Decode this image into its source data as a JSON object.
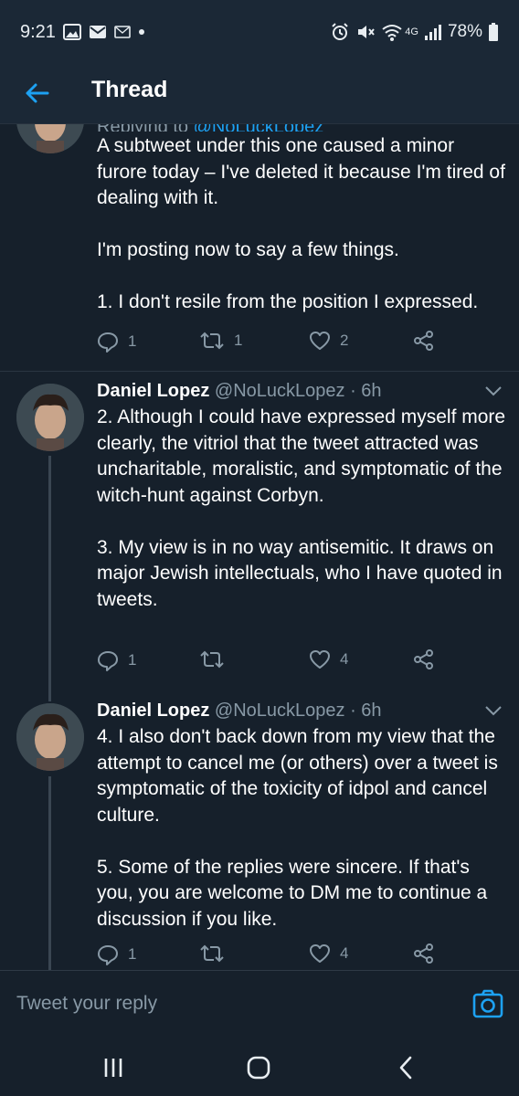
{
  "status_bar": {
    "time": "9:21",
    "network": "4G",
    "battery": "78%"
  },
  "header": {
    "title": "Thread"
  },
  "tweets": [
    {
      "replying_prefix": "Replying to",
      "replying_handle": "@NoLuckLopez",
      "text": "A subtweet under this one caused a minor furore today – I've deleted it because I'm tired of dealing with it.\n\nI'm posting now to say a few things.\n\n1. I don't resile from the position I expressed.",
      "replies": "1",
      "retweets": "1",
      "likes": "2"
    },
    {
      "name": "Daniel Lopez",
      "handle_time": "@NoLuckLopez · 6h",
      "text": "2. Although I could have expressed myself more clearly, the vitriol that the tweet attracted was uncharitable, moralistic, and symptomatic of the witch-hunt against Corbyn.\n\n3. My view is in no way antisemitic. It draws on major Jewish intellectuals, who I have quoted in tweets.",
      "replies": "1",
      "retweets": "",
      "likes": "4"
    },
    {
      "name": "Daniel Lopez",
      "handle_time": "@NoLuckLopez · 6h",
      "text": "4. I also don't back down from my view that the attempt to cancel me (or others) over a tweet is symptomatic of the toxicity of idpol and cancel culture.\n\n5. Some of the replies were sincere. If that's you, you are welcome to DM me to continue a discussion if you like.",
      "replies": "1",
      "retweets": "",
      "likes": "4"
    }
  ],
  "reply_bar": {
    "placeholder": "Tweet your reply"
  },
  "colors": {
    "background": "#16202b",
    "accent": "#1da1f2",
    "muted": "#8899a6"
  },
  "icons": [
    "gallery-icon",
    "mail-icon",
    "message-icon",
    "alarm-icon",
    "mute-icon",
    "wifi-icon",
    "signal-icon",
    "battery-icon",
    "back-arrow-icon",
    "reply-icon",
    "retweet-icon",
    "like-icon",
    "share-icon",
    "chevron-down-icon",
    "camera-icon",
    "recents-icon",
    "home-icon",
    "nav-back-icon"
  ]
}
